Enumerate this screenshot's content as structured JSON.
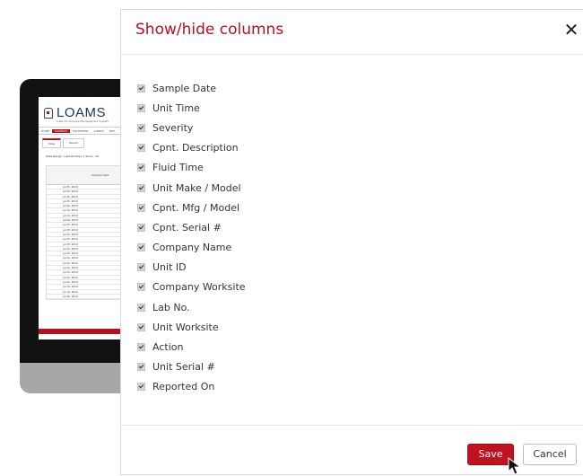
{
  "background_app": {
    "logo_text": "LOAMS",
    "logo_subtitle": "Lube Oil Analysis Management System",
    "nav": [
      "HOME",
      "SAMPLES",
      "EQUIPMENT",
      "LABELS",
      "REP"
    ],
    "tabs": [
      "View",
      "Search"
    ],
    "filter": "Date Range : Last 90 Days  ×  Show : All",
    "table_header": "Sample Date",
    "rows": [
      "Jul 25, 2019",
      "Jul 25, 2019",
      "Jul 25, 2019",
      "Jul 25, 2019",
      "Jul 06, 2019",
      "Jul 24, 2019",
      "Jul 24, 2019",
      "Jul 09, 2019",
      "Jul 23, 2019",
      "Jul 23, 2019",
      "Jul 23, 2019",
      "Jul 23, 2019",
      "Jul 23, 2019",
      "Jul 23, 2019",
      "Jul 23, 2019",
      "Jul 22, 2019",
      "Jul 22, 2019",
      "Jul 22, 2019",
      "Jul 22, 2019",
      "Jul 22, 2019",
      "Jul 22, 2019",
      "Jul 19, 2019",
      "Jul 19, 2019",
      "Jul 19, 2019"
    ],
    "accent_color": "#b4121f"
  },
  "modal": {
    "title": "Show/hide columns",
    "close_icon": "close-icon",
    "columns": [
      {
        "label": "Sample Date",
        "checked": true
      },
      {
        "label": "Unit Time",
        "checked": true
      },
      {
        "label": "Severity",
        "checked": true
      },
      {
        "label": "Cpnt. Description",
        "checked": true
      },
      {
        "label": "Fluid Time",
        "checked": true
      },
      {
        "label": "Unit Make / Model",
        "checked": true
      },
      {
        "label": "Cpnt. Mfg / Model",
        "checked": true
      },
      {
        "label": "Cpnt. Serial #",
        "checked": true
      },
      {
        "label": "Company Name",
        "checked": true
      },
      {
        "label": "Unit ID",
        "checked": true
      },
      {
        "label": "Company Worksite",
        "checked": true
      },
      {
        "label": "Lab No.",
        "checked": true
      },
      {
        "label": "Unit Worksite",
        "checked": true
      },
      {
        "label": "Action",
        "checked": true
      },
      {
        "label": "Unit Serial #",
        "checked": true
      },
      {
        "label": "Reported On",
        "checked": true
      }
    ],
    "save_label": "Save",
    "cancel_label": "Cancel",
    "title_color": "#b4121f",
    "save_color": "#c1121f"
  }
}
